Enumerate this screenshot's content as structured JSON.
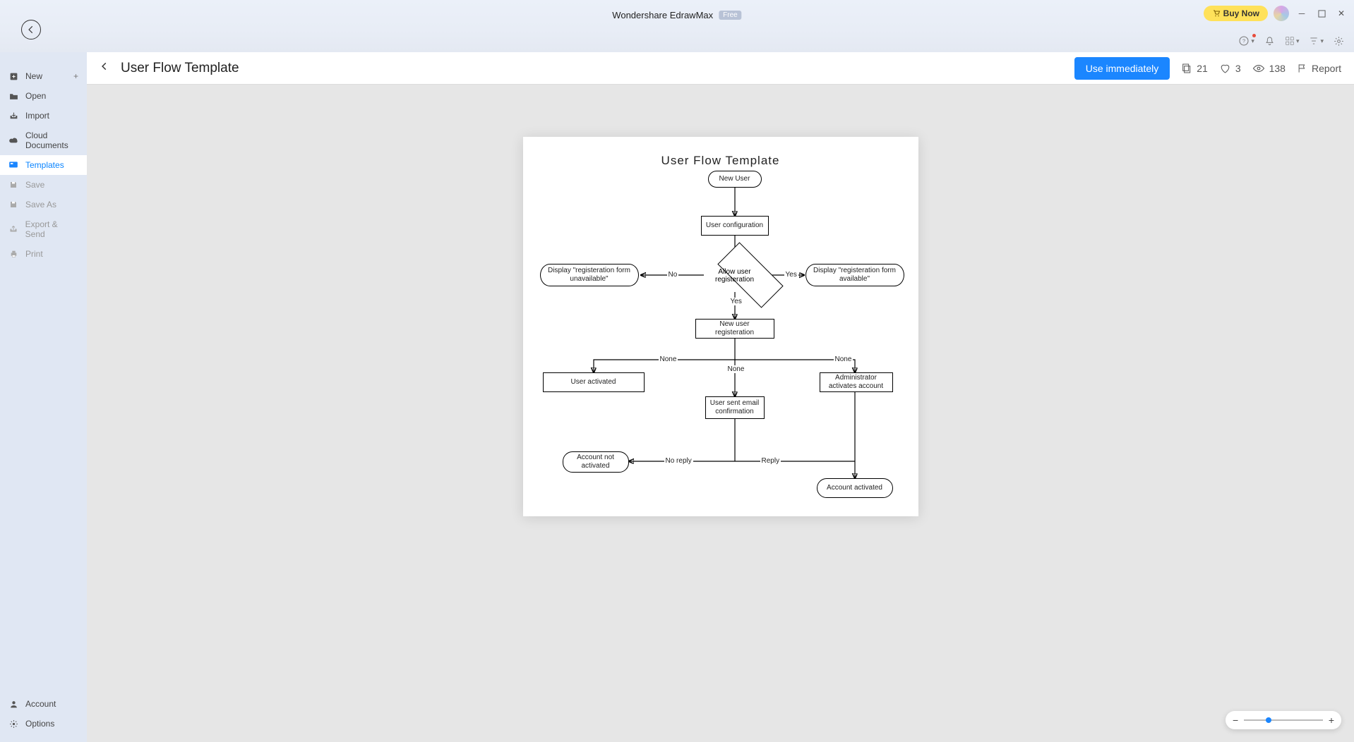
{
  "app": {
    "title": "Wondershare EdrawMax",
    "edition": "Free",
    "buy_label": "Buy Now"
  },
  "sidebar": {
    "items": [
      {
        "label": "New"
      },
      {
        "label": "Open"
      },
      {
        "label": "Import"
      },
      {
        "label": "Cloud Documents"
      },
      {
        "label": "Templates"
      },
      {
        "label": "Save"
      },
      {
        "label": "Save As"
      },
      {
        "label": "Export & Send"
      },
      {
        "label": "Print"
      }
    ],
    "bottom": [
      {
        "label": "Account"
      },
      {
        "label": "Options"
      }
    ]
  },
  "page": {
    "title": "User Flow Template",
    "use_button": "Use immediately",
    "copies": "21",
    "likes": "3",
    "views": "138",
    "report": "Report"
  },
  "diagram": {
    "title": "User Flow Template",
    "nodes": {
      "new_user": "New User",
      "user_config": "User configuration",
      "allow": "Allow user registeration",
      "disp_unavail": "Display \"registeration form unavailable\"",
      "disp_avail": "Display \"registeration form available\"",
      "new_reg": "New user registeration",
      "user_activated": "User activated",
      "admin_act": "Administrator activates account",
      "email_conf": "User sent email confirmation",
      "acct_not": "Account not activated",
      "acct_act": "Account activated"
    },
    "edges": {
      "no": "No",
      "yes": "Yes",
      "yes2": "Yes",
      "none1": "None",
      "none2": "None",
      "none3": "None",
      "noreply": "No reply",
      "reply": "Reply"
    }
  }
}
